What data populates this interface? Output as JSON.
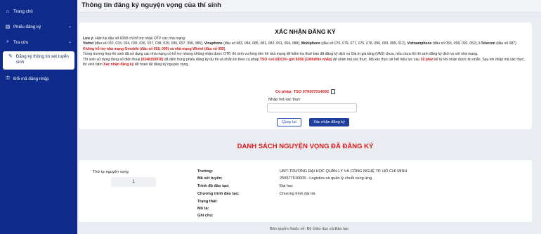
{
  "sidebar": {
    "items": [
      {
        "label": "Trang chủ",
        "icon": "home-icon",
        "glyph": "⌂",
        "chevron": ""
      },
      {
        "label": "Phiếu đăng ký",
        "icon": "document-icon",
        "glyph": "▤",
        "chevron": "⌄"
      },
      {
        "label": "Tra cứu",
        "icon": "search-icon",
        "glyph": "⌕",
        "chevron": "⌄"
      },
      {
        "label": "Đăng ký thông tin xét tuyển sinh",
        "icon": "edit-icon",
        "glyph": "✎",
        "chevron": ""
      },
      {
        "label": "Đổi mã đăng nhập",
        "icon": "key-icon",
        "glyph": "⚿",
        "chevron": ""
      }
    ]
  },
  "page": {
    "title": "Thông tin đăng ký nguyện vọng của thí sinh"
  },
  "confirm": {
    "title": "XÁC NHẬN ĐĂNG KÝ",
    "note_prefix": "Lưu ý:",
    "note_line1": "Hiện tại đầu số 6058 chỉ hỗ trợ nhận OTP các nhà mạng:",
    "viettel_name": "Viettel",
    "viettel_numbers": "(đầu số 032, 033, 034, 035, 036, 037, 038, 039, 096, 097, 098, 086),",
    "vina_name": "Vinaphone",
    "vina_numbers": "(đầu số 083, 084, 085, 081, 082, 091, 094, 088),",
    "mobi_name": "Mobiphone",
    "mobi_numbers": "(đầu số 070, 079, 077, 076, 078, 090, 093, 089, 012),",
    "vietnamobile_name": "Vietnamphone",
    "vietnamobile_numbers": "(đầu số 056, 058, 092, 052),",
    "itel_name": "I-Telecom",
    "itel_numbers": "(đầu số 087)",
    "unsupported": "Không hỗ trợ nhà mạng Gmobile (đầu số 059, 099) và nhà mạng Wintel (đầu số 055)",
    "para_otp": "Trong trường hợp thí sinh đã sử dụng các nhà mạng có hỗ trợ nhưng không nhận được OTP, thí sinh vui lòng liên hệ nhà mạng để kiểm tra thuê bao đã đăng ký dịch vụ Giá trị gia tăng (VAS) chưa, nếu chưa thì thí sinh đăng ký dịch vụ với nhà mạng.",
    "para_phone_a": "Thí sinh sử dụng đúng số điện thoại",
    "phone": "(0348159976)",
    "para_phone_b": "đã điền trong phiếu đăng ký dự thi và nhắn tin theo cú pháp",
    "sms_syntax": "TSO <số ĐDCN> gửi 6058 (1000đ/tin nhắn)",
    "para_phone_c": "để nhận mã xác thực. Mã xác thực sẽ hết hiệu lực sau",
    "expiry": "30 phút",
    "para_phone_d": "kể từ khi nhận được tin nhắn. Sau khi nhập mã xác thực, thí sinh bấm",
    "confirm_phrase": "Xác nhận đăng ký",
    "para_phone_e": "để hoàn tất đăng ký nguyện vọng.",
    "syntax_line": "Cú pháp: TSO 079307014092",
    "code_label": "Nhập mã xác thực",
    "code_value": "",
    "back_button": "Quay lại",
    "confirm_button": "Xác nhận đăng ký"
  },
  "list": {
    "heading": "DANH SÁCH NGUYỆN VỌNG ĐÃ ĐĂNG KÝ",
    "order_label": "Thứ tự nguyện vọng",
    "order_value": "1",
    "fields": [
      {
        "key": "Trường:",
        "value": "UMT-TRƯỜNG ĐẠI HỌC QUẢN LÝ VÀ CÔNG NGHỆ TP. HỒ CHÍ MINH"
      },
      {
        "key": "Mã xét tuyển:",
        "value": "250577510605 - Logistics và quản lý chuỗi cung ứng"
      },
      {
        "key": "Trình độ đào tạo:",
        "value": "Đại học"
      },
      {
        "key": "Chương trình đào tạo:",
        "value": "Chương trình đại trà"
      },
      {
        "key": "Trạng thái:",
        "value": ""
      },
      {
        "key": "Mô tả:",
        "value": ""
      },
      {
        "key": "Ghi chú:",
        "value": ""
      }
    ]
  },
  "footer": {
    "text": "Bản quyền thuộc về: Bộ Giáo dục và Đào tạo"
  }
}
